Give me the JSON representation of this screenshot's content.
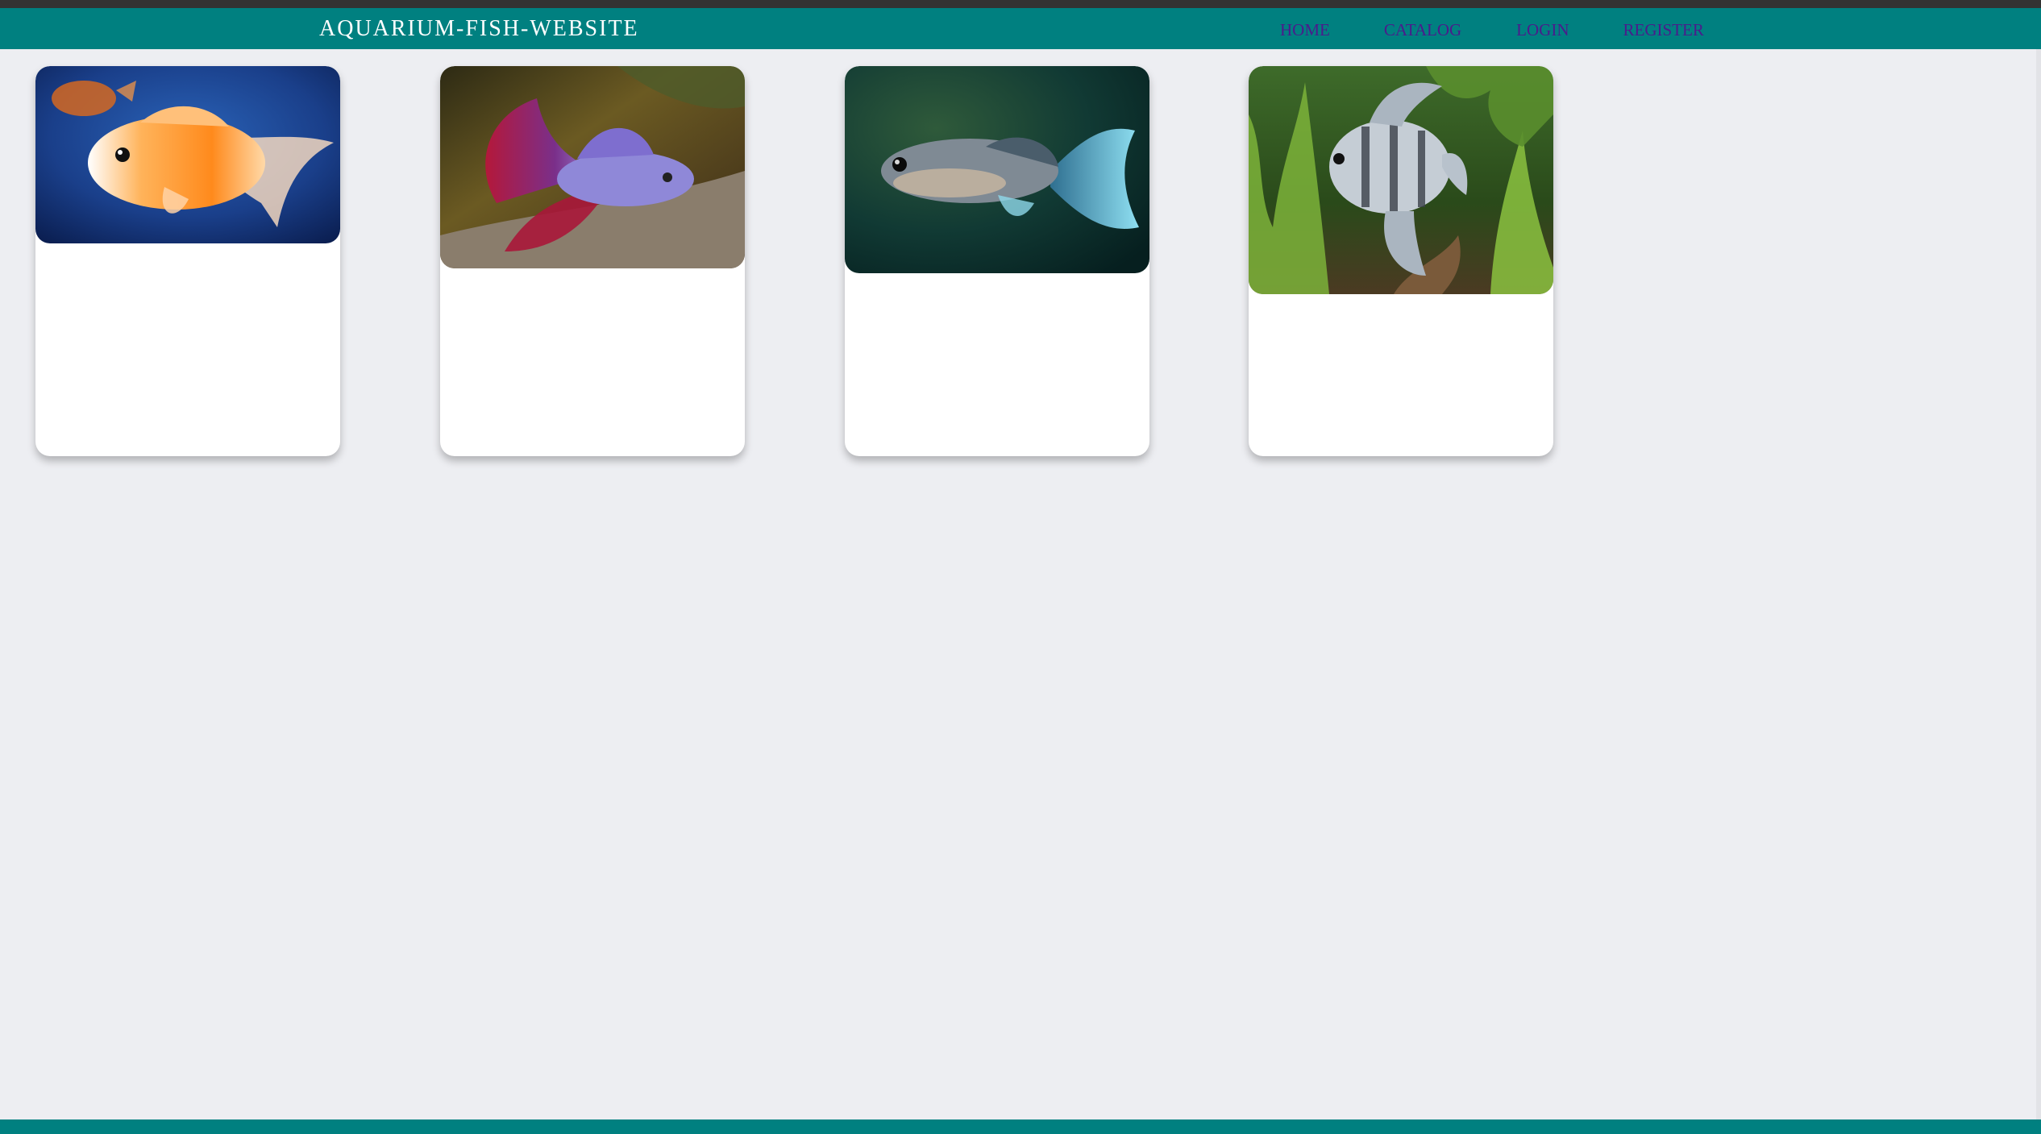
{
  "header": {
    "brand": "AQUARIUM-FISH-WEBSITE",
    "brand_color": "#ffffff",
    "background_color": "#008080",
    "nav": [
      {
        "label": "HOME"
      },
      {
        "label": "CATALOG"
      },
      {
        "label": "LOGIN"
      },
      {
        "label": "REGISTER"
      }
    ],
    "nav_link_color": "#4b1b8c"
  },
  "cards": [
    {
      "image": "goldfish-photo"
    },
    {
      "image": "betta-fish-photo"
    },
    {
      "image": "guppy-photo"
    },
    {
      "image": "angelfish-photo"
    }
  ],
  "footer": {
    "background_color": "#008080"
  }
}
